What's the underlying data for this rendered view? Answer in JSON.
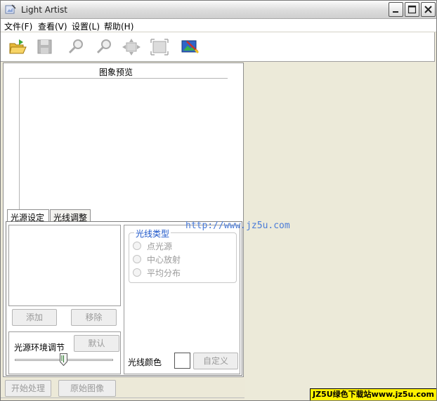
{
  "window": {
    "title": "Light Artist"
  },
  "menu": {
    "file": "文件(F)",
    "view": "查看(V)",
    "settings": "设置(L)",
    "help": "帮助(H)"
  },
  "toolbar": {
    "icons": [
      "open-folder-icon",
      "save-disk-icon",
      "zoom-in-icon",
      "zoom-out-icon",
      "fit-window-icon",
      "actual-size-icon",
      "render-picture-icon"
    ]
  },
  "preview": {
    "label": "图象预览"
  },
  "tabs": {
    "light_source": "光源设定",
    "light_adjust": "光线调整"
  },
  "light_source": {
    "add": "添加",
    "remove": "移除",
    "ambient_label": "光源环境调节",
    "default": "默认"
  },
  "light_type": {
    "legend": "光线类型",
    "options": [
      "点光源",
      "中心放射",
      "平均分布"
    ]
  },
  "light_color": {
    "label": "光线颜色",
    "custom": "自定义",
    "swatch_color": "#ffffff"
  },
  "bottom": {
    "start": "开始处理",
    "original": "原始图像"
  },
  "watermark": {
    "url": "http://www.jz5u.com",
    "badge": "JZ5U绿色下载站www.jz5u.com"
  }
}
